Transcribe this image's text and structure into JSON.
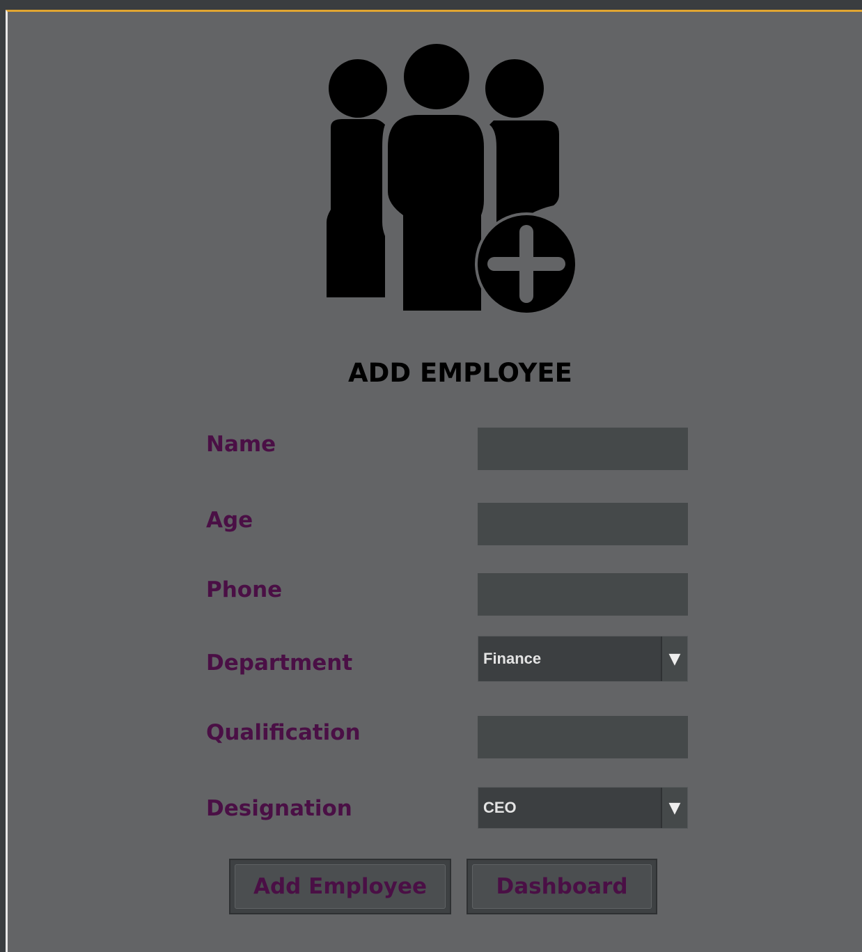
{
  "form": {
    "title": "ADD EMPLOYEE",
    "fields": {
      "name": {
        "label": "Name",
        "value": ""
      },
      "age": {
        "label": "Age",
        "value": ""
      },
      "phone": {
        "label": "Phone",
        "value": ""
      },
      "department": {
        "label": "Department",
        "selected": "Finance"
      },
      "qualification": {
        "label": "Qualification",
        "value": ""
      },
      "designation": {
        "label": "Designation",
        "selected": "CEO"
      }
    },
    "buttons": {
      "add": "Add Employee",
      "dashboard": "Dashboard"
    }
  },
  "icons": {
    "logo": "add-group-icon",
    "dropdown": "triangle-down-icon"
  },
  "colors": {
    "panel_bg": "#636466",
    "label_text": "#4a0f45",
    "field_bg": "#45494a",
    "title_text": "#000000"
  }
}
